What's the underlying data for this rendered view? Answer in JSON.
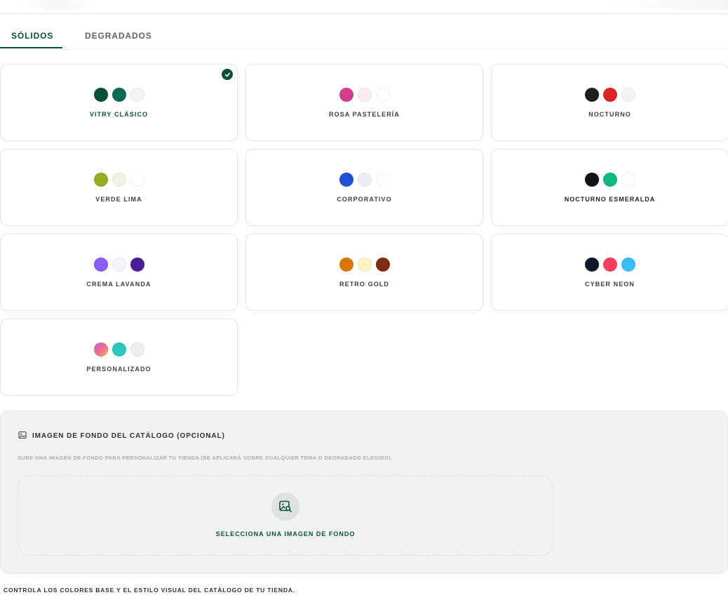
{
  "tabs": [
    {
      "label": "SÓLIDOS",
      "active": true
    },
    {
      "label": "DEGRADADOS",
      "active": false
    }
  ],
  "themes": [
    {
      "name": "VITRY CLÁSICO",
      "selected": true,
      "colors": [
        "#0b4d3c",
        "#0d6a52",
        "#f3f4f3"
      ]
    },
    {
      "name": "ROSA PASTELERÍA",
      "selected": false,
      "colors": [
        "#d23f8a",
        "#fbe9f0",
        "#ffffff"
      ]
    },
    {
      "name": "NOCTURNO",
      "selected": false,
      "colors": [
        "#1e1e1e",
        "#dc2626",
        "#f3f4f3"
      ]
    },
    {
      "name": "VERDE LIMA",
      "selected": false,
      "colors": [
        "#9aaa1e",
        "#f1f3e4",
        "#ffffff"
      ]
    },
    {
      "name": "CORPORATIVO",
      "selected": false,
      "colors": [
        "#1f4fd6",
        "#e9eef8",
        "#ffffff"
      ]
    },
    {
      "name": "NOCTURNO ESMERALDA",
      "selected": false,
      "colors": [
        "#0f1418",
        "#10b981",
        "#ffffff"
      ]
    },
    {
      "name": "CREMA LAVANDA",
      "selected": false,
      "colors": [
        "#8b5cf6",
        "#f5f3fb",
        "#4c1d95"
      ]
    },
    {
      "name": "RETRO GOLD",
      "selected": false,
      "colors": [
        "#d97706",
        "#fdf3c7",
        "#7c2d12"
      ]
    },
    {
      "name": "CYBER NEON",
      "selected": false,
      "colors": [
        "#0f172a",
        "#f43f5e",
        "#38bdf8"
      ]
    },
    {
      "name": "PERSONALIZADO",
      "selected": false,
      "colors": [
        "gradient",
        "#2cc7c1",
        "#eeeeee"
      ]
    }
  ],
  "background_section": {
    "title": "IMAGEN DE FONDO DEL CATÁLOGO (OPCIONAL)",
    "subtitle": "SUBE UNA IMAGEN DE FONDO PARA PERSONALIZAR TU TIENDA (SE APLICARÁ SOBRE CUALQUIER TEMA O DEGRADADO ELEGIDO).",
    "select_label": "SELECCIONA UNA IMAGEN DE FONDO"
  },
  "footer_note": "CONTROLA LOS COLORES BASE Y EL ESTILO VISUAL DEL CATÁLOGO DE TU TIENDA.",
  "colors": {
    "accent": "#0d4d3d",
    "panel_bg": "#f1f3f2"
  },
  "icons": {
    "selected": "check-icon",
    "section": "image-icon",
    "dropzone": "image-search-icon"
  }
}
